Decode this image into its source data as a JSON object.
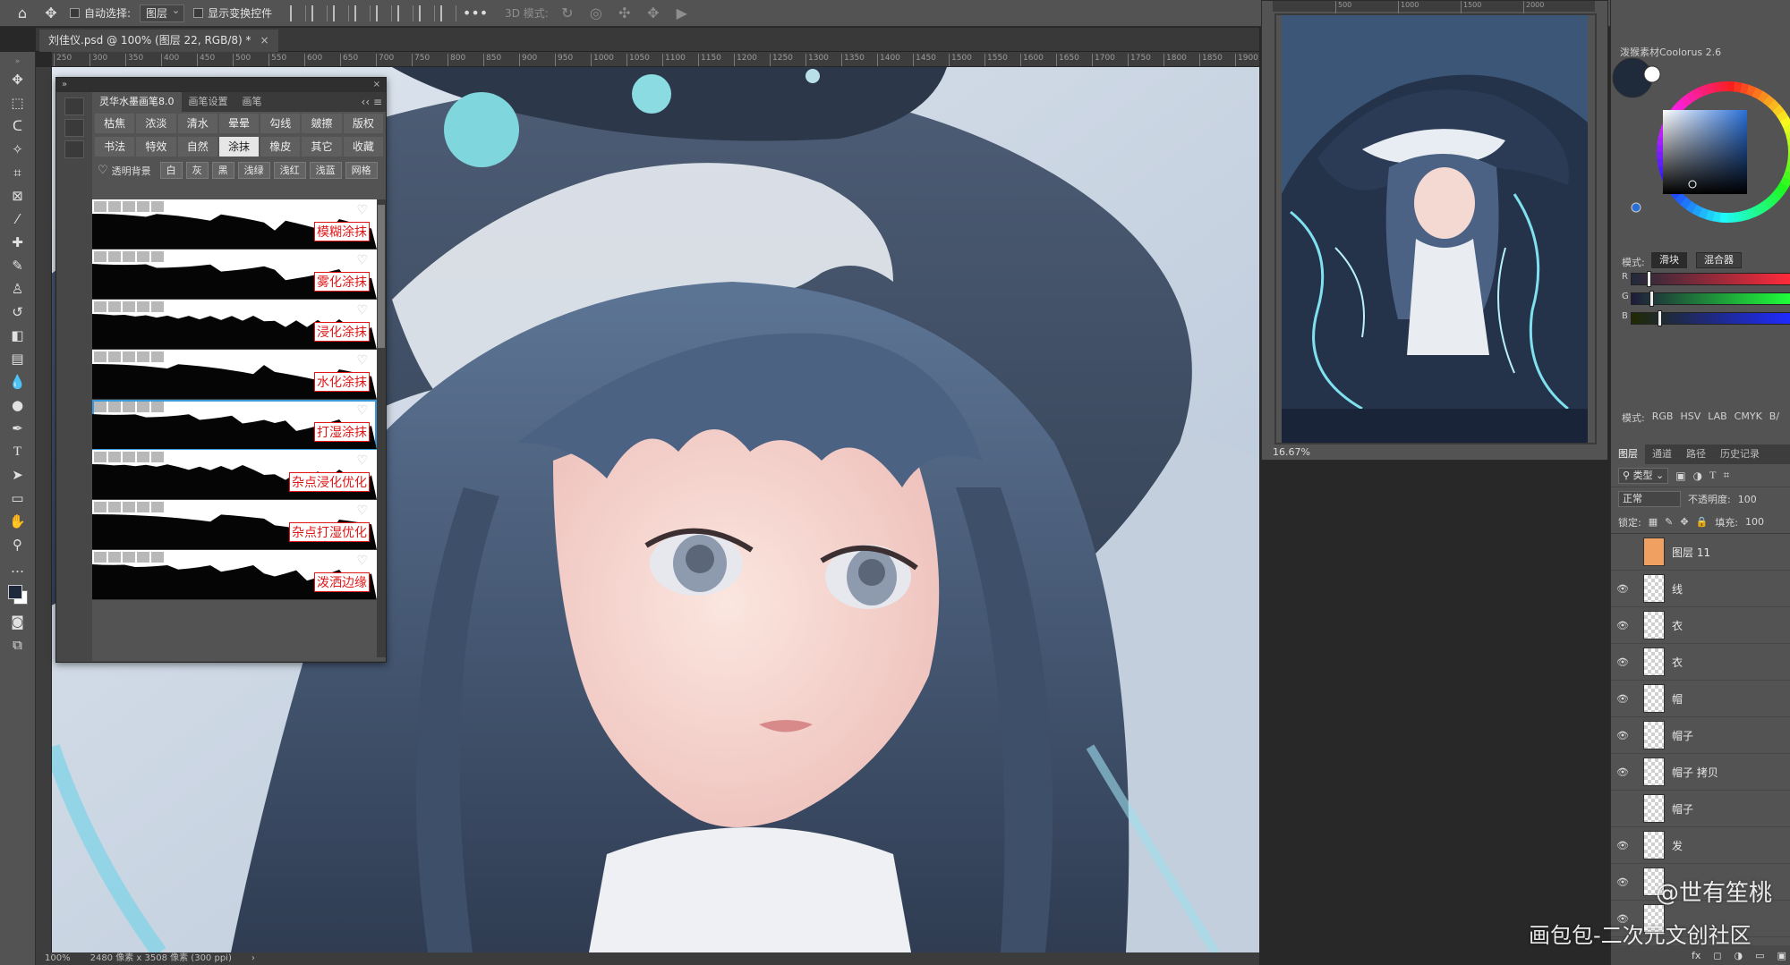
{
  "options_bar": {
    "auto_select_label": "自动选择:",
    "auto_select_value": "图层",
    "show_transform_label": "显示变换控件",
    "more": "•••",
    "mode_3d_label": "3D 模式:"
  },
  "document_tab": {
    "title": "刘佳仪.psd @ 100% (图层 22, RGB/8) *",
    "close": "×"
  },
  "ruler_top_ticks": [
    "250",
    "300",
    "350",
    "400",
    "450",
    "500",
    "550",
    "600",
    "650",
    "700",
    "750",
    "800",
    "850",
    "900",
    "950",
    "1000",
    "1050",
    "1100",
    "1150",
    "1200",
    "1250",
    "1300",
    "1350",
    "1400",
    "1450",
    "1500",
    "1550",
    "1600",
    "1650",
    "1700",
    "1750",
    "1800",
    "1850",
    "1900"
  ],
  "status_bar": {
    "zoom": "100%",
    "doc_info": "2480 像素 x 3508 像素 (300 ppi)",
    "arrow": "›"
  },
  "brush_panel": {
    "header_left": "»",
    "header_close": "×",
    "tabs": [
      "灵华水墨画笔8.0",
      "画笔设置",
      "画笔"
    ],
    "menu": "‹‹ ≡",
    "categories_row1": [
      "枯焦",
      "浓淡",
      "清水",
      "晕晕",
      "勾线",
      "皴擦",
      "版权"
    ],
    "categories_row2": [
      "书法",
      "特效",
      "自然",
      "涂抹",
      "橡皮",
      "其它",
      "收藏"
    ],
    "active_category": "涂抹",
    "transparent_bg_label": "透明背景",
    "bg_options": [
      "白",
      "灰",
      "黑",
      "浅绿",
      "浅红",
      "浅蓝",
      "网格"
    ],
    "brushes": [
      {
        "name": "模糊涂抹",
        "selected": false
      },
      {
        "name": "雾化涂抹",
        "selected": false
      },
      {
        "name": "浸化涂抹",
        "selected": false
      },
      {
        "name": "水化涂抹",
        "selected": false
      },
      {
        "name": "打湿涂抹",
        "selected": true
      },
      {
        "name": "杂点浸化优化",
        "selected": false
      },
      {
        "name": "杂点打湿优化",
        "selected": false
      },
      {
        "name": "泼洒边缘",
        "selected": false
      }
    ]
  },
  "navigator": {
    "zoom": "16.67%",
    "ruler_ticks": [
      "500",
      "1000",
      "1500",
      "2000"
    ]
  },
  "coolorus": {
    "title": "泼猴素材Coolorus 2.6",
    "mode_label": "模式:",
    "mode_buttons": [
      "滑块",
      "混合器"
    ],
    "active_mode": "滑块",
    "sliders": [
      {
        "key": "R",
        "level": 0.1
      },
      {
        "key": "G",
        "level": 0.12
      },
      {
        "key": "B",
        "level": 0.17
      }
    ],
    "color_modes_label": "模式:",
    "color_modes": [
      "RGB",
      "HSV",
      "LAB",
      "CMYK",
      "B/"
    ],
    "current_color": "#1f2a3a",
    "hash": "#"
  },
  "layers_panel": {
    "tabs": [
      "图层",
      "通道",
      "路径",
      "历史记录"
    ],
    "filter_label": "类型",
    "blend_mode": "正常",
    "opacity_label": "不透明度:",
    "opacity_value": "100",
    "lock_label": "锁定:",
    "fill_label": "填充:",
    "fill_value": "100",
    "layers": [
      {
        "name": "图层 11",
        "visible": false,
        "thumb": "orange"
      },
      {
        "name": "线",
        "visible": true,
        "thumb": "empty"
      },
      {
        "name": "衣",
        "visible": true,
        "thumb": "empty"
      },
      {
        "name": "衣",
        "visible": true,
        "thumb": "empty"
      },
      {
        "name": "帽",
        "visible": true,
        "thumb": "empty"
      },
      {
        "name": "帽子",
        "visible": true,
        "thumb": "empty"
      },
      {
        "name": "帽子 拷贝",
        "visible": true,
        "thumb": "empty"
      },
      {
        "name": "帽子",
        "visible": false,
        "thumb": "empty"
      },
      {
        "name": "发",
        "visible": true,
        "thumb": "empty"
      },
      {
        "name": "",
        "visible": true,
        "thumb": "empty"
      },
      {
        "name": "",
        "visible": true,
        "thumb": "empty"
      }
    ],
    "bottom_icons": [
      "fx",
      "◻",
      "◑",
      "▭",
      "▣",
      "🗑"
    ]
  },
  "watermark": {
    "line1": "@世有笙桃",
    "line2": "画包包-二次元文创社区"
  }
}
